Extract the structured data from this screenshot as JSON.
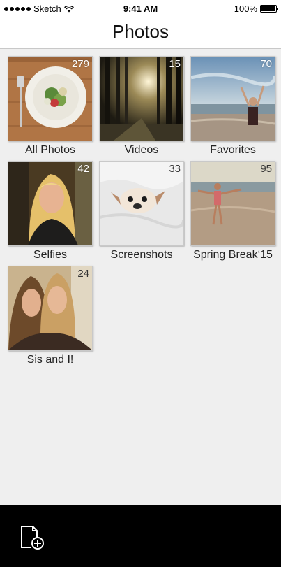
{
  "status": {
    "carrier": "Sketch",
    "time": "9:41 AM",
    "battery": "100%"
  },
  "nav": {
    "title": "Photos"
  },
  "albums": [
    {
      "label": "All Photos",
      "count": "279"
    },
    {
      "label": "Videos",
      "count": "15"
    },
    {
      "label": "Favorites",
      "count": "70"
    },
    {
      "label": "Selfies",
      "count": "42"
    },
    {
      "label": "Screenshots",
      "count": "33"
    },
    {
      "label": "Spring Break‘15",
      "count": "95"
    },
    {
      "label": "Sis and I!",
      "count": "24"
    }
  ],
  "icons": {
    "signal": "signal-dots-icon",
    "wifi": "wifi-icon",
    "battery": "battery-icon",
    "add_album": "add-album-icon"
  },
  "colors": {
    "background": "#efefef",
    "bottom_bar": "#000000"
  }
}
